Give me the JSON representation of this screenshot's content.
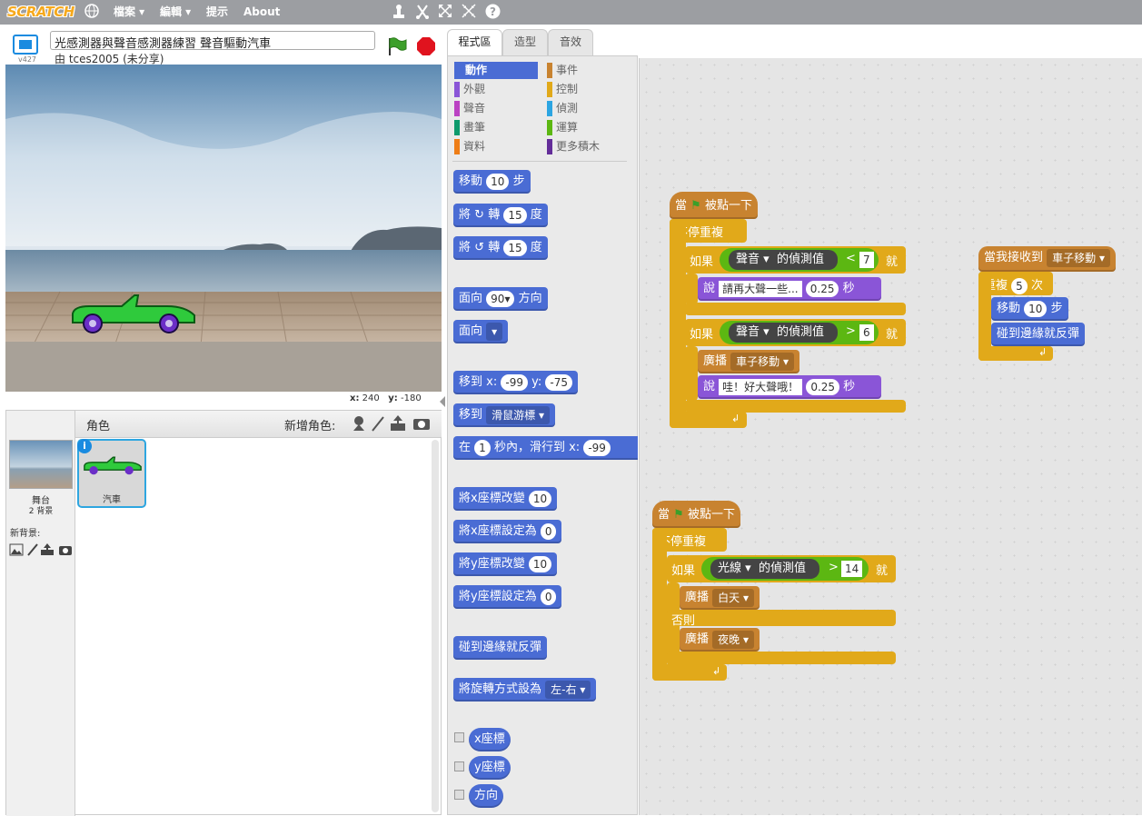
{
  "menubar": {
    "logo": "SCRATCH",
    "file": "檔案 ▾",
    "edit": "編輯 ▾",
    "tips": "提示",
    "about": "About"
  },
  "project": {
    "version": "v427",
    "title": "光感測器與聲音感測器練習 聲音驅動汽車",
    "author": "由 tces2005 (未分享)"
  },
  "coords": {
    "x_label": "x:",
    "x": "240",
    "y_label": "y:",
    "y": "-180"
  },
  "sprites": {
    "header": "角色",
    "new_sprite": "新增角色:",
    "stage_label": "舞台",
    "backdrops": "2 背景",
    "new_backdrop": "新背景:",
    "sprite_name": "汽車"
  },
  "tabs": {
    "scripts": "程式區",
    "costumes": "造型",
    "sounds": "音效"
  },
  "categories": {
    "motion": "動作",
    "looks": "外觀",
    "sound": "聲音",
    "pen": "畫筆",
    "data": "資料",
    "events": "事件",
    "control": "控制",
    "sensing": "偵測",
    "operators": "運算",
    "more": "更多積木"
  },
  "palette": {
    "move": "移動",
    "move_n": "10",
    "steps": "步",
    "turn": "將",
    "turn_cw": "轉",
    "turn_n": "15",
    "deg": "度",
    "point": "面向",
    "point_n": "90",
    "dir": "方向",
    "point_towards": "面向",
    "goto": "移到",
    "x": "x:",
    "goto_x": "-99",
    "y": "y:",
    "goto_y": "-75",
    "goto_mouse": "移到",
    "mouse": "滑鼠游標",
    "glide": "在",
    "glide_n": "1",
    "glide_txt": "秒內，滑行到",
    "glide_x": "-99",
    "chx": "將x座標改變",
    "chx_n": "10",
    "setx": "將x座標設定為",
    "setx_n": "0",
    "chy": "將y座標改變",
    "chy_n": "10",
    "sety": "將y座標設定為",
    "sety_n": "0",
    "bounce": "碰到邊緣就反彈",
    "rot": "將旋轉方式設為",
    "rot_v": "左-右",
    "xpos": "x座標",
    "ypos": "y座標",
    "direction": "方向"
  },
  "script1": {
    "when": "當",
    "clicked": "被點一下",
    "forever": "不停重複",
    "if": "如果",
    "then": "就",
    "sound": "聲音",
    "value": "的偵測值",
    "lt": "<",
    "n7": "7",
    "say": "說",
    "say1": "請再大聲一些...",
    "secs1": "0.25",
    "sec": "秒",
    "gt": ">",
    "n6": "6",
    "broadcast": "廣播",
    "msg": "車子移動",
    "say2": "哇！好大聲哦！",
    "secs2": "0.25"
  },
  "script2": {
    "when": "當我接收到",
    "msg": "車子移動",
    "repeat": "重複",
    "n": "5",
    "times": "次",
    "move": "移動",
    "move_n": "10",
    "steps": "步",
    "bounce": "碰到邊緣就反彈"
  },
  "script3": {
    "when": "當",
    "clicked": "被點一下",
    "forever": "不停重複",
    "if": "如果",
    "then": "就",
    "light": "光線",
    "value": "的偵測值",
    "gt": ">",
    "n": "14",
    "broadcast": "廣播",
    "day": "白天",
    "else": "否則",
    "night": "夜晚"
  }
}
